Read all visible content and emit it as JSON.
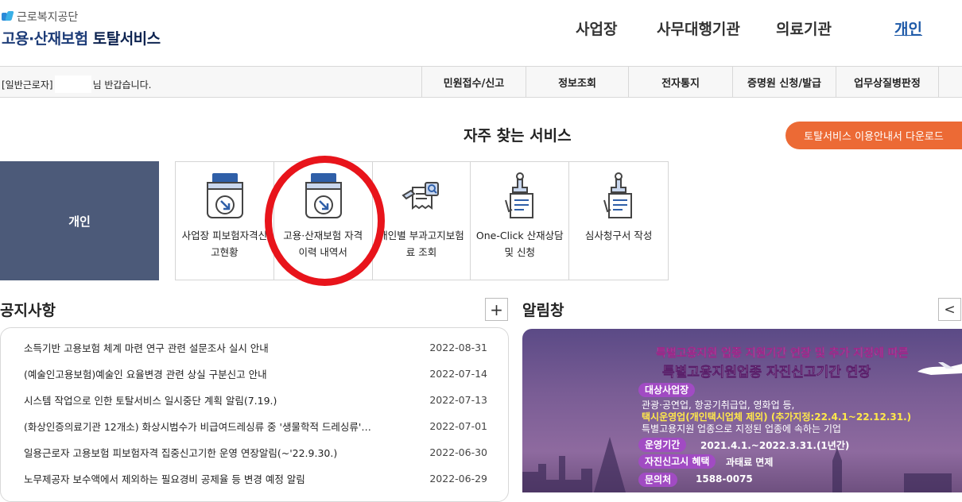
{
  "logo": {
    "org": "근로복지공단",
    "title_a": "고용·산재보험",
    "title_b": "토탈서비스"
  },
  "gnb": {
    "items": [
      "사업장",
      "사무대행기관",
      "의료기관",
      "개인"
    ],
    "active": "개인"
  },
  "greeting": {
    "prefix": "[일반근로자]",
    "suffix": "님 반갑습니다."
  },
  "subnav": {
    "items": [
      "민원접수/신고",
      "정보조회",
      "전자통지",
      "증명원 신청/발급",
      "업무상질병판정"
    ]
  },
  "frequent": {
    "title": "자주 찾는 서비스",
    "download_label": "토탈서비스 이용안내서 다운로드",
    "side_tab": "개인",
    "services": [
      {
        "label": "사업장 피보험자격신고현황",
        "icon": "folder-arrow-icon"
      },
      {
        "label": "고용·산재보험 자격 이력 내역서",
        "icon": "folder-arrow-icon"
      },
      {
        "label": "개인별 부과고지보험료 조회",
        "icon": "document-search-icon"
      },
      {
        "label": "One-Click 산재상담 및 신청",
        "icon": "stamp-document-icon"
      },
      {
        "label": "심사청구서 작성",
        "icon": "stamp-document-icon"
      }
    ]
  },
  "notice": {
    "title": "공지사항",
    "more_label": "+",
    "rows": [
      {
        "title": "소득기반 고용보험 체계 마련 연구 관련 설문조사 실시 안내",
        "date": "2022-08-31"
      },
      {
        "title": "(예술인고용보험)예술인 요율변경 관련 상실 구분신고 안내",
        "date": "2022-07-14"
      },
      {
        "title": "시스템 작업으로 인한 토탈서비스 일시중단 계획 알림(7.19.)",
        "date": "2022-07-13"
      },
      {
        "title": "(화상인증의료기관 12개소) 화상시범수가 비급여드레싱류 중 '생물학적 드레싱류'…",
        "date": "2022-07-01"
      },
      {
        "title": "일용근로자 고용보험 피보험자격 집중신고기한 운영 연장알림(~'22.9.30.)",
        "date": "2022-06-30"
      },
      {
        "title": "노무제공자 보수액에서 제외하는 필요경비 공제율 등 변경 예정 알림",
        "date": "2022-06-29"
      }
    ]
  },
  "alert": {
    "title": "알림창",
    "prev_label": "<",
    "banner": {
      "line1": "특별고용지원 업종 지원기간 연장 및 추가 지정에 따른",
      "line2a": "특별고용지원업종",
      "line2b": "자진신고기간 연장",
      "target_label": "대상사업장",
      "target_1": "관광·공연업, 항공기취급업, 영화업 등,",
      "target_2": "택시운영업(개인택시업체 제외) (추가지정:22.4.1~22.12.31.)",
      "target_3": "특별고용지원 업종으로 지정된 업종에 속하는 기업",
      "period_label": "운영기간",
      "period_value": "2021.4.1.~2022.3.31.(1년간)",
      "benefit_label": "자진신고시 혜택",
      "benefit_value": "과태료 면제",
      "contact_label": "문의처",
      "contact_value": "1588-0075"
    }
  },
  "colors": {
    "brand": "#1d3c78",
    "accent": "#ec6a35",
    "side_tile": "#4c5a79",
    "highlight_circle": "#e8141b"
  }
}
